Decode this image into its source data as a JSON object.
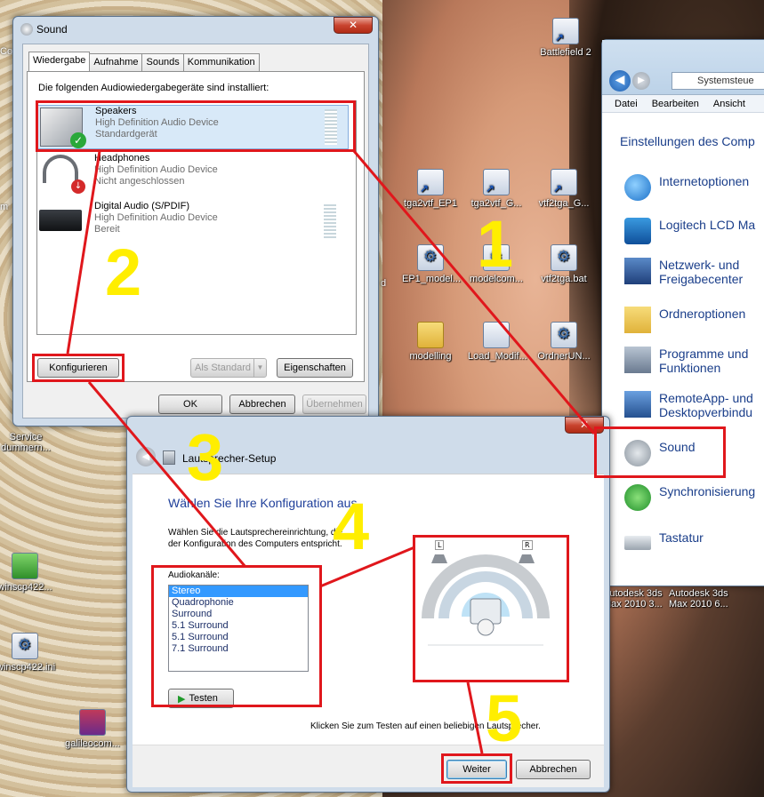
{
  "desktop": {
    "icons_top": [
      "Battlefield 2"
    ],
    "icons_row1": [
      "tga2vtf_EP1",
      "tga2vtf_G...",
      "vtf2tga_G..."
    ],
    "icons_row2": [
      "EP1_model...",
      "modelcom...",
      "vtf2tga.bat"
    ],
    "icons_row3": [
      "modelling",
      "Load_Modif...",
      "OrdnerUN..."
    ],
    "icons_left": [
      "Service dummern...",
      "winscp422...",
      "winscp422.ini",
      "galileocom..."
    ],
    "icons_bottom_right": [
      "Autodesk 3ds Max 2010 3...",
      "Autodesk 3ds Max 2010 6..."
    ],
    "left_fragments": [
      "Co",
      "m",
      "d"
    ]
  },
  "sound_dialog": {
    "title": "Sound",
    "close": "✕",
    "tabs": [
      "Wiedergabe",
      "Aufnahme",
      "Sounds",
      "Kommunikation"
    ],
    "intro": "Die folgenden Audiowiedergabegeräte sind installiert:",
    "devices": [
      {
        "name": "Speakers",
        "driver": "High Definition Audio Device",
        "status": "Standardgerät"
      },
      {
        "name": "Headphones",
        "driver": "High Definition Audio Device",
        "status": "Nicht angeschlossen"
      },
      {
        "name": "Digital Audio (S/PDIF)",
        "driver": "High Definition Audio Device",
        "status": "Bereit"
      }
    ],
    "configure": "Konfigurieren",
    "set_default": "Als Standard",
    "properties": "Eigenschaften",
    "ok": "OK",
    "cancel": "Abbrechen",
    "apply": "Übernehmen"
  },
  "control_panel": {
    "address": "Systemsteue",
    "menu": [
      "Datei",
      "Bearbeiten",
      "Ansicht"
    ],
    "heading": "Einstellungen des Comp",
    "items": [
      {
        "label": "Internetoptionen",
        "label2": ""
      },
      {
        "label": "Logitech LCD Ma",
        "label2": ""
      },
      {
        "label": "Netzwerk- und",
        "label2": "Freigabecenter"
      },
      {
        "label": "Ordneroptionen",
        "label2": ""
      },
      {
        "label": "Programme und",
        "label2": "Funktionen"
      },
      {
        "label": "RemoteApp- und",
        "label2": "Desktopverbindu"
      },
      {
        "label": "Sound",
        "label2": ""
      },
      {
        "label": "Synchronisierung",
        "label2": ""
      },
      {
        "label": "Tastatur",
        "label2": ""
      }
    ]
  },
  "speaker_setup": {
    "title": "Lautsprecher-Setup",
    "heading": "Wählen Sie Ihre Konfiguration aus.",
    "desc1": "Wählen Sie die Lautsprechereinrichtung, die",
    "desc2": "der Konfiguration des Computers entspricht.",
    "channels_label": "Audiokanäle:",
    "options": [
      "Stereo",
      "Quadrophonie",
      "Surround",
      "5.1 Surround",
      "5.1 Surround",
      "7.1 Surround"
    ],
    "test": "Testen",
    "speaker_left": "L",
    "speaker_right": "R",
    "hint": "Klicken Sie zum Testen auf einen beliebigen Lautsprecher.",
    "next": "Weiter",
    "cancel": "Abbrechen",
    "close": "✕"
  },
  "annotations": {
    "n1": "1",
    "n2": "2",
    "n3": "3",
    "n4": "4",
    "n5": "5"
  },
  "colors": {
    "annotation_red": "#e0171c",
    "annotation_yellow": "#ffee00",
    "selection": "#3399ff",
    "link_blue": "#1a3e8a"
  }
}
